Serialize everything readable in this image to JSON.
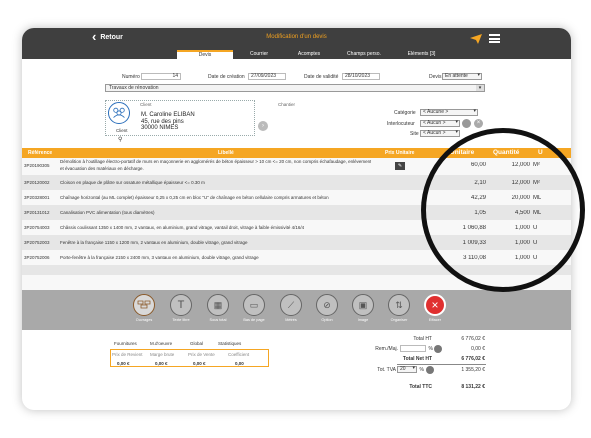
{
  "topbar": {
    "back": "Retour",
    "title": "Modification d'un devis"
  },
  "tabs": [
    "Devis",
    "Courrier",
    "Acomptes",
    "Champs perso.",
    "Eléments [3]"
  ],
  "form": {
    "numero_label": "Numéro",
    "numero": "14",
    "date_creation_label": "Date de création",
    "date_creation": "27/09/2023",
    "date_validite_label": "Date de validité",
    "date_validite": "28/10/2023",
    "devis_label": "Devis",
    "devis_status": "En attente",
    "objet": "Travaux de rénovation"
  },
  "client": {
    "caption": "Client",
    "name": "M. Caroline ELIBAN",
    "address1": "45, rue des pins",
    "address2": "30000 NIMES",
    "icon_label": "Client",
    "chantier": "Chantier"
  },
  "right_fields": {
    "categorie_label": "Catégorie",
    "categorie": "< Aucune >",
    "interlocuteur_label": "Interlocuteur",
    "interlocuteur": "< Aucun >",
    "site_label": "Site",
    "site": "< Aucun >"
  },
  "table": {
    "headers": {
      "reference": "Référence",
      "libelle": "Libellé",
      "prix_unitaire": "Prix Unitaire",
      "prix_unitaire_big": "Unitaire",
      "quantite": "Quantité",
      "unite": "U"
    },
    "rows": [
      {
        "ref": "3P20190305",
        "lib1": "Démolition à l'outillage électro-portatif de murs en maçonnerie en agglomérés de béton épaisseur > 10 cm <= 20 cm, non compris échafaudage, enlèvement",
        "lib2": "et évacuation des matériaux en décharge.",
        "pu": "60,00",
        "qte": "12,000",
        "u": "M²"
      },
      {
        "ref": "3P20120002",
        "lib1": "Cloison en plaque de plâtre sur ossature métallique épaisseur <= 0.30 m",
        "lib2": "",
        "pu": "2,10",
        "qte": "12,000",
        "u": "M²"
      },
      {
        "ref": "3P20328001",
        "lib1": "Chaînage horizontal (au ML complet) épaisseur 0,25 x 0,25 cm en bloc \"U\" de chaînage en béton cellulaire compris armatures et béton",
        "lib2": "",
        "pu": "42,29",
        "qte": "20,000",
        "u": "ML"
      },
      {
        "ref": "3P20131012",
        "lib1": "Canalisation PVC alimentation (tous diamètres)",
        "lib2": "",
        "pu": "1,05",
        "qte": "4,500",
        "u": "ML"
      },
      {
        "ref": "3P20754003",
        "lib1": "Châssis coulissant 1350 x 1400 mm, 2 vantaux, en aluminium, grand vitrage, vantail droit, vitrage à faible émissivité 4/16/4",
        "lib2": "",
        "pu": "1 060,88",
        "qte": "1,000",
        "u": "U"
      },
      {
        "ref": "3P20752003",
        "lib1": "Fenêtre à la française 1150 x 1200 mm, 2 vantaux en aluminium, double vitrage, grand vitrage",
        "lib2": "",
        "pu": "1 009,33",
        "qte": "1,000",
        "u": "U"
      },
      {
        "ref": "3P20752006",
        "lib1": "Porte-fenêtre à la française 2150 x 2400 mm, 3 vantaux en aluminium, double vitrage, grand vitrage",
        "lib2": "",
        "pu": "3 110,08",
        "qte": "1,000",
        "u": "U"
      }
    ]
  },
  "toolbar": [
    "Ouvrages",
    "Texte libre",
    "Sous total",
    "Bas de page",
    "Métrés",
    "Option",
    "Image",
    "Organiser",
    "Effacer"
  ],
  "bottom": {
    "fournitures": "Fournitures",
    "mo": "M.d'oeuvre",
    "global": "Global",
    "statistiques": "Statistiques",
    "prix_revient_label": "Prix de Revient",
    "marge_brute_label": "Marge brute",
    "prix_vente_label": "Prix de Vente",
    "coefficient_label": "Coefficient",
    "prix_revient": "0,00 €",
    "marge_brute": "0,00 €",
    "prix_vente": "0,00 €",
    "coefficient": "0,00",
    "total_ht_label": "Total HT",
    "total_ht": "6 776,02 €",
    "rem_maj_label": "Rem./Maj.",
    "rem_pct": "%",
    "rem_val": "0,00 €",
    "total_net_ht_label": "Total Net HT",
    "total_net_ht": "6 776,02 €",
    "tot_tva_label": "Tot. TVA",
    "tva_rate": "20",
    "tva_pct": "%",
    "tot_tva": "1 355,20 €",
    "total_ttc_label": "Total TTC",
    "total_ttc": "8 131,22 €"
  },
  "colors": {
    "accent": "#f5a623",
    "dark": "#3f3f3f",
    "toolbar": "#a9a9a9",
    "danger": "#e03030"
  }
}
